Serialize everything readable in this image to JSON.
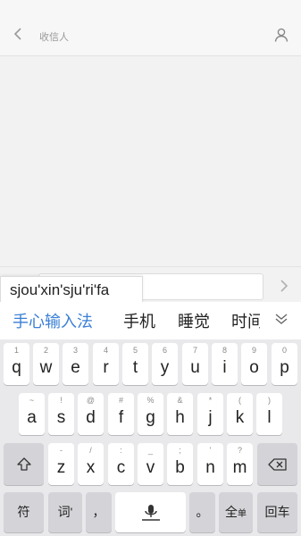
{
  "header": {
    "title": "收信人",
    "back_icon": "chevron-left-icon",
    "contact_icon": "person-icon"
  },
  "compose": {
    "send_icon": "chevron-right-icon",
    "pinyin": "sjou'xin'sju'ri'fa"
  },
  "candidates": [
    "手心输入法",
    "手机",
    "睡觉",
    "时间"
  ],
  "keyboard": {
    "row1": [
      {
        "k": "q",
        "h": "1"
      },
      {
        "k": "w",
        "h": "2"
      },
      {
        "k": "e",
        "h": "3"
      },
      {
        "k": "r",
        "h": "4"
      },
      {
        "k": "t",
        "h": "5"
      },
      {
        "k": "y",
        "h": "6"
      },
      {
        "k": "u",
        "h": "7"
      },
      {
        "k": "i",
        "h": "8"
      },
      {
        "k": "o",
        "h": "9"
      },
      {
        "k": "p",
        "h": "0"
      }
    ],
    "row2": [
      {
        "k": "a",
        "h": "~"
      },
      {
        "k": "s",
        "h": "!"
      },
      {
        "k": "d",
        "h": "@"
      },
      {
        "k": "f",
        "h": "#"
      },
      {
        "k": "g",
        "h": "%"
      },
      {
        "k": "h",
        "h": "&"
      },
      {
        "k": "j",
        "h": "*"
      },
      {
        "k": "k",
        "h": "("
      },
      {
        "k": "l",
        "h": ")"
      }
    ],
    "row3": [
      {
        "k": "z",
        "h": "-"
      },
      {
        "k": "x",
        "h": "/"
      },
      {
        "k": "c",
        "h": ":"
      },
      {
        "k": "v",
        "h": "_"
      },
      {
        "k": "b",
        "h": ";"
      },
      {
        "k": "n",
        "h": "'"
      },
      {
        "k": "m",
        "h": "?"
      }
    ],
    "symbols_label": "符",
    "separator_label": "词'",
    "comma_label": "，",
    "period_label": "。",
    "fullwidth_label": "全",
    "fullwidth_sub": "单",
    "enter_label": "回车",
    "shift_icon": "shift-arrow-icon",
    "backspace_icon": "backspace-icon",
    "mic_icon": "microphone-icon"
  },
  "colors": {
    "accent": "#3a7fd5"
  }
}
